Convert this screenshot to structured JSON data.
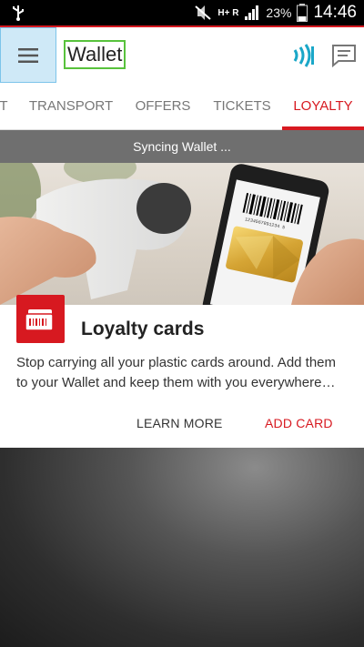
{
  "status": {
    "network": "H+ R",
    "battery": "23%",
    "time": "14:46"
  },
  "appbar": {
    "title": "Wallet"
  },
  "tabs": [
    {
      "label": "T"
    },
    {
      "label": "TRANSPORT"
    },
    {
      "label": "OFFERS"
    },
    {
      "label": "TICKETS"
    },
    {
      "label": "LOYALTY"
    }
  ],
  "sync": {
    "text": "Syncing Wallet ..."
  },
  "hero": {
    "barcode_number": "1234567891234 5"
  },
  "card": {
    "title": "Loyalty cards",
    "description": "Stop carrying all your plastic cards around. Add them to your Wallet and keep them with you everywhere…",
    "learn_more": "LEARN MORE",
    "add_card": "ADD CARD"
  },
  "colors": {
    "accent": "#d71920",
    "nfc": "#1aa7c8",
    "menu_highlight": "#cfe9f7",
    "title_highlight": "#58c23c"
  }
}
